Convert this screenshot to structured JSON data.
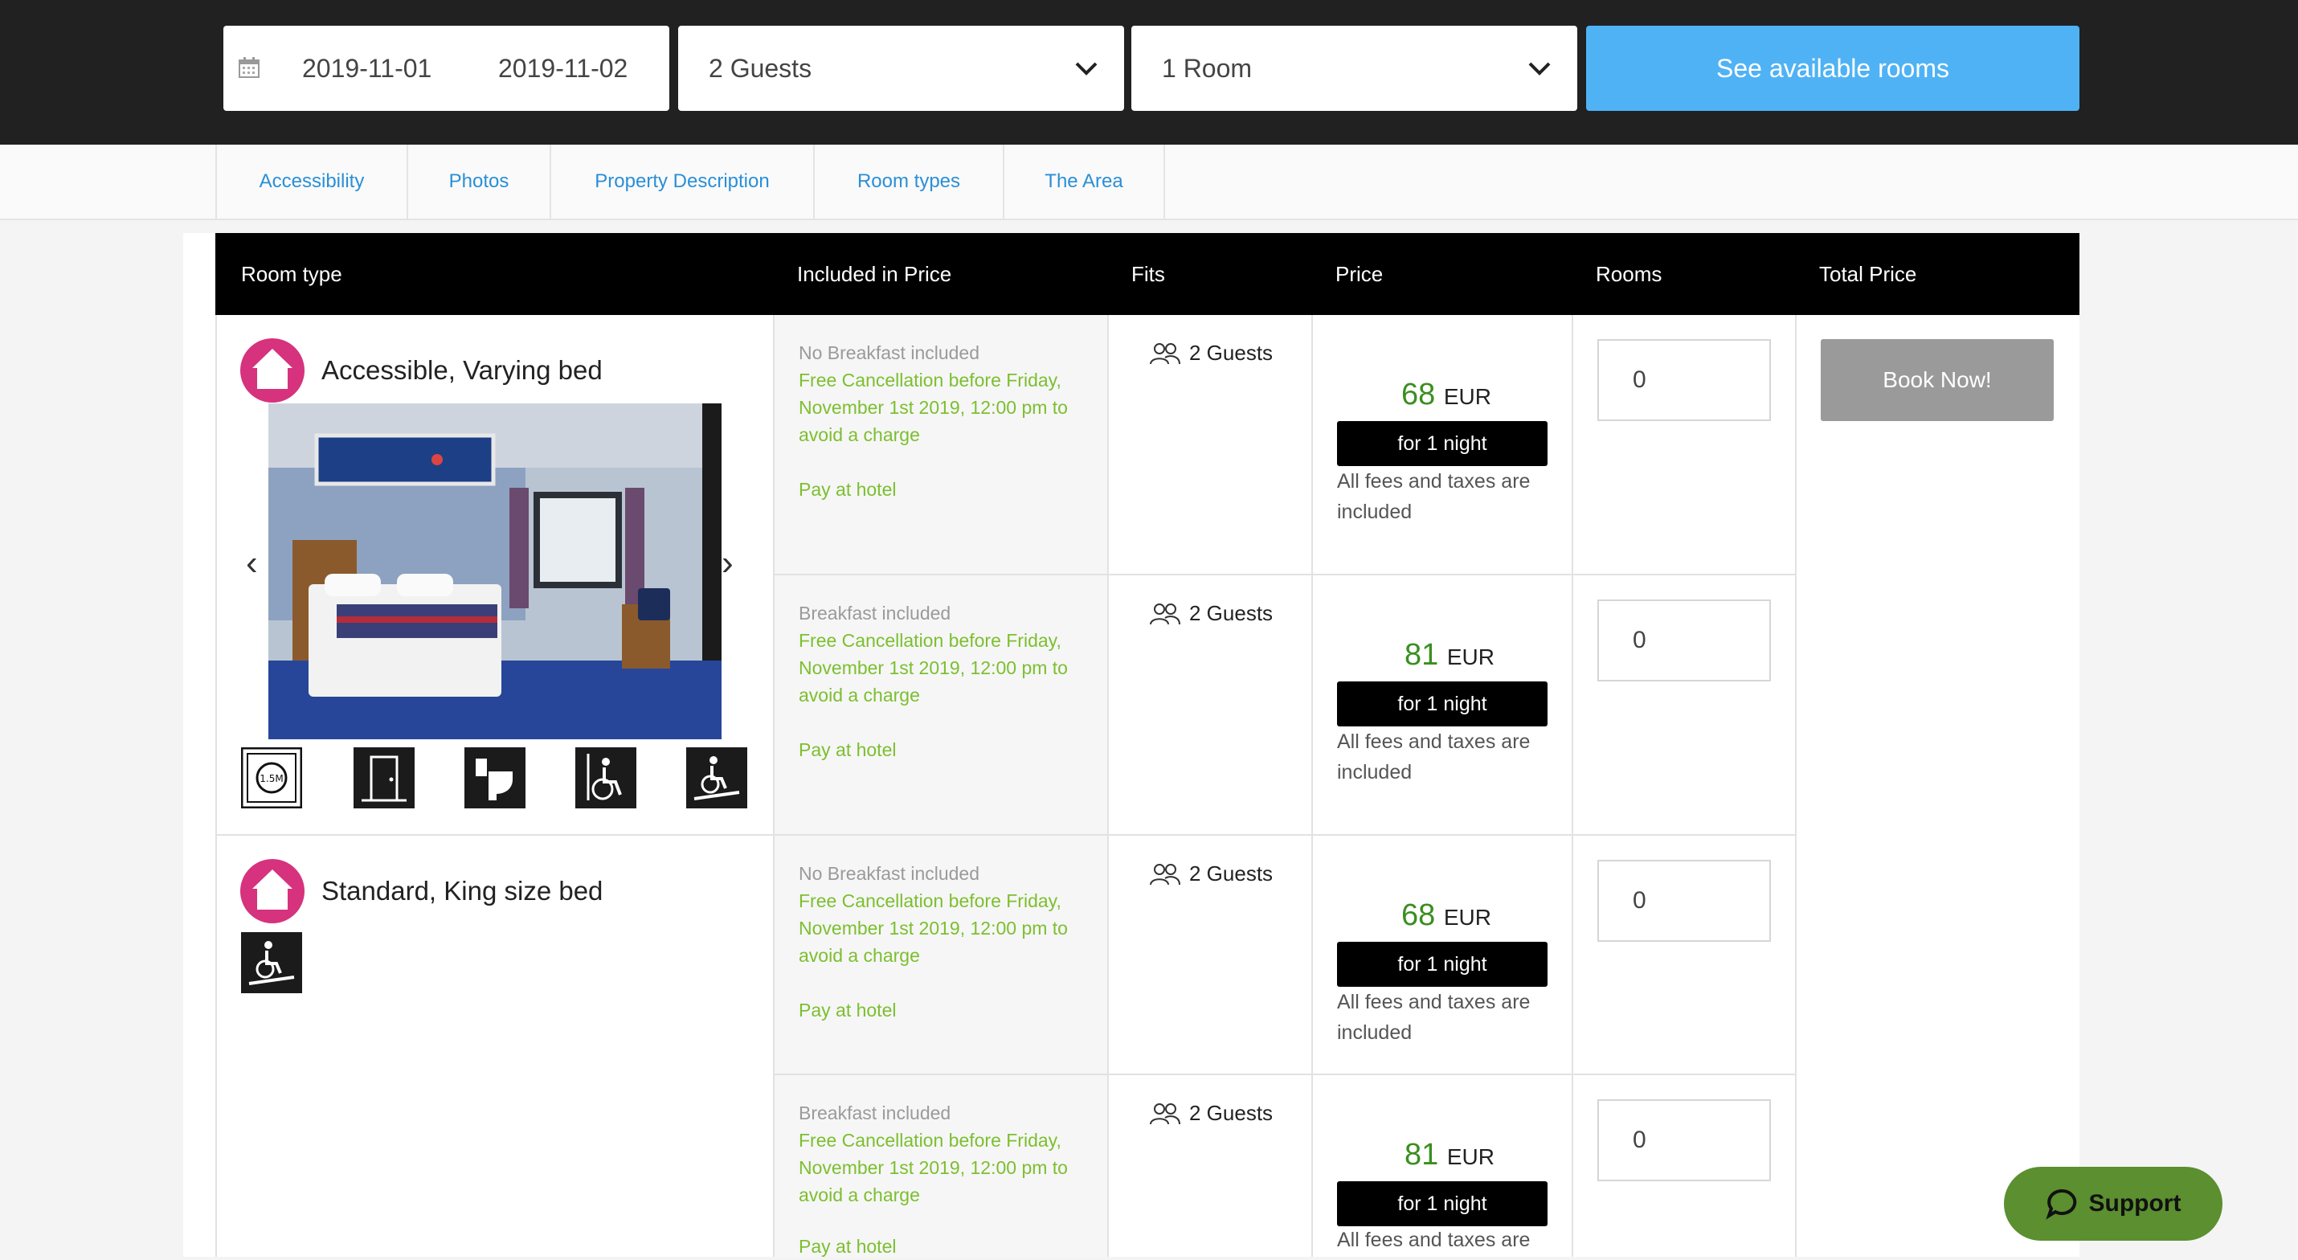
{
  "search": {
    "check_in": "2019-11-01",
    "check_out": "2019-11-02",
    "guests": "2 Guests",
    "rooms": "1 Room",
    "submit_label": "See available rooms"
  },
  "tabs": [
    {
      "label": "Accessibility"
    },
    {
      "label": "Photos"
    },
    {
      "label": "Property Description"
    },
    {
      "label": "Room types"
    },
    {
      "label": "The Area"
    }
  ],
  "table": {
    "headers": {
      "room_type": "Room type",
      "included": "Included in Price",
      "fits": "Fits",
      "price": "Price",
      "rooms": "Rooms",
      "total": "Total Price"
    },
    "book_label": "Book Now!"
  },
  "room_types": [
    {
      "name": "Accessible, Varying bed"
    },
    {
      "name": "Standard, King size bed"
    }
  ],
  "rates": [
    {
      "breakfast": "No Breakfast included",
      "cancellation": "Free Cancellation before Friday, November 1st 2019, 12:00 pm to avoid a charge",
      "payment": "Pay at hotel",
      "fits": "2 Guests",
      "price": "68",
      "currency": "EUR",
      "nights": "for 1 night",
      "fees": "All fees and taxes are included",
      "rooms_value": "0"
    },
    {
      "breakfast": "Breakfast included",
      "cancellation": "Free Cancellation before Friday, November 1st 2019, 12:00 pm to avoid a charge",
      "payment": "Pay at hotel",
      "fits": "2 Guests",
      "price": "81",
      "currency": "EUR",
      "nights": "for 1 night",
      "fees": "All fees and taxes are included",
      "rooms_value": "0"
    },
    {
      "breakfast": "No Breakfast included",
      "cancellation": "Free Cancellation before Friday, November 1st 2019, 12:00 pm to avoid a charge",
      "payment": "Pay at hotel",
      "fits": "2 Guests",
      "price": "68",
      "currency": "EUR",
      "nights": "for 1 night",
      "fees": "All fees and taxes are included",
      "rooms_value": "0"
    },
    {
      "breakfast": "Breakfast included",
      "cancellation": "Free Cancellation before Friday, November 1st 2019, 12:00 pm to avoid a charge",
      "payment": "Pay at hotel",
      "fits": "2 Guests",
      "price": "81",
      "currency": "EUR",
      "nights": "for 1 night",
      "fees": "All fees and taxes are",
      "rooms_value": "0"
    }
  ],
  "support": {
    "label": "Support"
  },
  "colors": {
    "accent_blue": "#4fb2f5",
    "price_green": "#3a8f1f",
    "policy_green": "#7cbf2f",
    "brand_pink": "#d6327d",
    "support_green": "#5b8f2f"
  }
}
